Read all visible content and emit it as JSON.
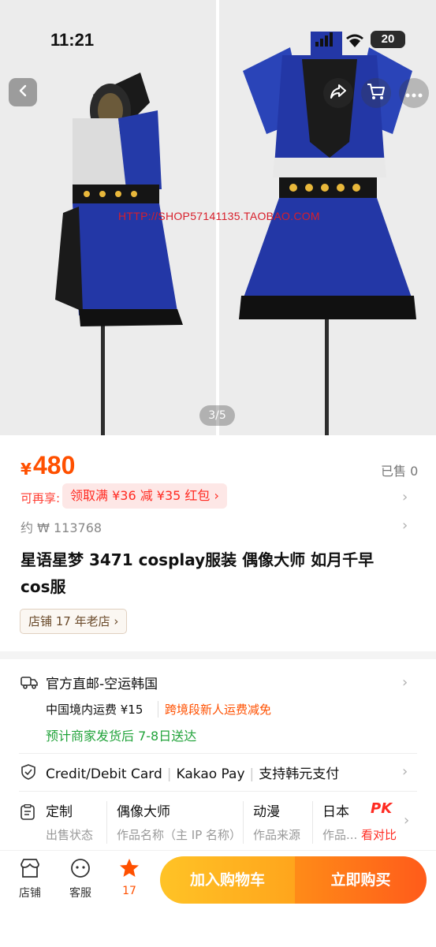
{
  "status_bar": {
    "time": "11:21",
    "battery": "20"
  },
  "gallery": {
    "watermark": "HTTP://SHOP57141135.TAOBAO.COM",
    "pager": "3/5"
  },
  "product": {
    "currency_symbol": "¥",
    "price": "480",
    "sold": "已售 0",
    "promo_label": "可再享:",
    "promo_chip": "领取满 ¥36 减 ¥35 红包",
    "approx_price": "约 ₩ 113768",
    "title": "星语星梦 3471 cosplay服装 偶像大师 如月千早 cos服",
    "shop_age": "店铺 17 年老店"
  },
  "shipping": {
    "title": "官方直邮-空运韩国",
    "domestic_fee": "中国境内运费 ¥15",
    "fee_tag": "跨境段新人运费减免",
    "eta": "预计商家发货后 7-8日送达"
  },
  "payment": {
    "methods": [
      "Credit/Debit Card",
      "Kakao Pay",
      "支持韩元支付"
    ]
  },
  "attributes": [
    {
      "value": "定制",
      "key": "出售状态"
    },
    {
      "value": "偶像大师",
      "key": "作品名称（主 IP 名称）"
    },
    {
      "value": "动漫",
      "key": "作品来源"
    },
    {
      "value": "日本",
      "key": "作品..."
    }
  ],
  "compare": {
    "badge": "PK",
    "label": "看对比"
  },
  "bottom_bar": {
    "store_label": "店铺",
    "service_label": "客服",
    "favorite_count": "17",
    "add_to_cart": "加入购物车",
    "buy_now": "立即购买",
    "accent_orange": "#ff5000",
    "cart_yellow": "#ffb020"
  }
}
